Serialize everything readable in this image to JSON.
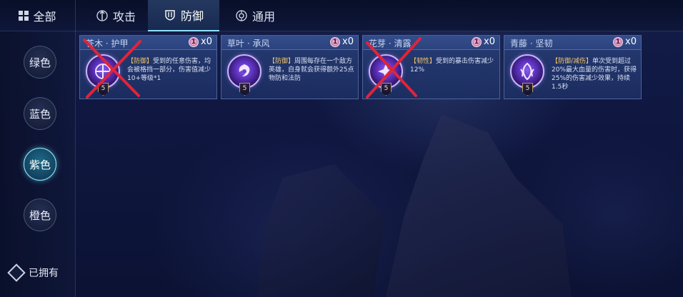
{
  "topbar": {
    "all_label": "全部",
    "tabs": [
      {
        "label": "攻击",
        "icon": "sword-icon",
        "active": false
      },
      {
        "label": "防御",
        "icon": "shield-icon",
        "active": true
      },
      {
        "label": "通用",
        "icon": "compass-icon",
        "active": false
      }
    ]
  },
  "sidebar": {
    "colors": [
      {
        "label": "绿色",
        "active": false
      },
      {
        "label": "蓝色",
        "active": false
      },
      {
        "label": "紫色",
        "active": true
      },
      {
        "label": "橙色",
        "active": false
      }
    ],
    "owned_label": "已拥有"
  },
  "cards": [
    {
      "title": "苍木 · 护甲",
      "badge": "1",
      "count": "x0",
      "level": "5",
      "tag": "【防御】",
      "desc": "受到的任意伤害，均会被格挡一部分，伤害值减少10+等级*1",
      "crossed": true
    },
    {
      "title": "草叶 · 承风",
      "badge": "1",
      "count": "x0",
      "level": "5",
      "tag": "【防御】",
      "desc": "周围每存在一个敌方英雄，自身就会获得额外25点物防和法防",
      "crossed": false
    },
    {
      "title": "花芽 · 清露",
      "badge": "1",
      "count": "x0",
      "level": "5",
      "tag": "【韧性】",
      "desc": "受到的暴击伤害减少12%",
      "crossed": true
    },
    {
      "title": "青藤 · 坚韧",
      "badge": "1",
      "count": "x0",
      "level": "5",
      "tag": "【防御/减伤】",
      "desc": "单次受到超过20%最大血量的伤害时，获得25%的伤害减少效果，持续1.5秒",
      "crossed": false
    }
  ],
  "colors": {
    "accent": "#8fe0ff",
    "cross": "#e0243a",
    "card_bg": "#2c4278"
  }
}
